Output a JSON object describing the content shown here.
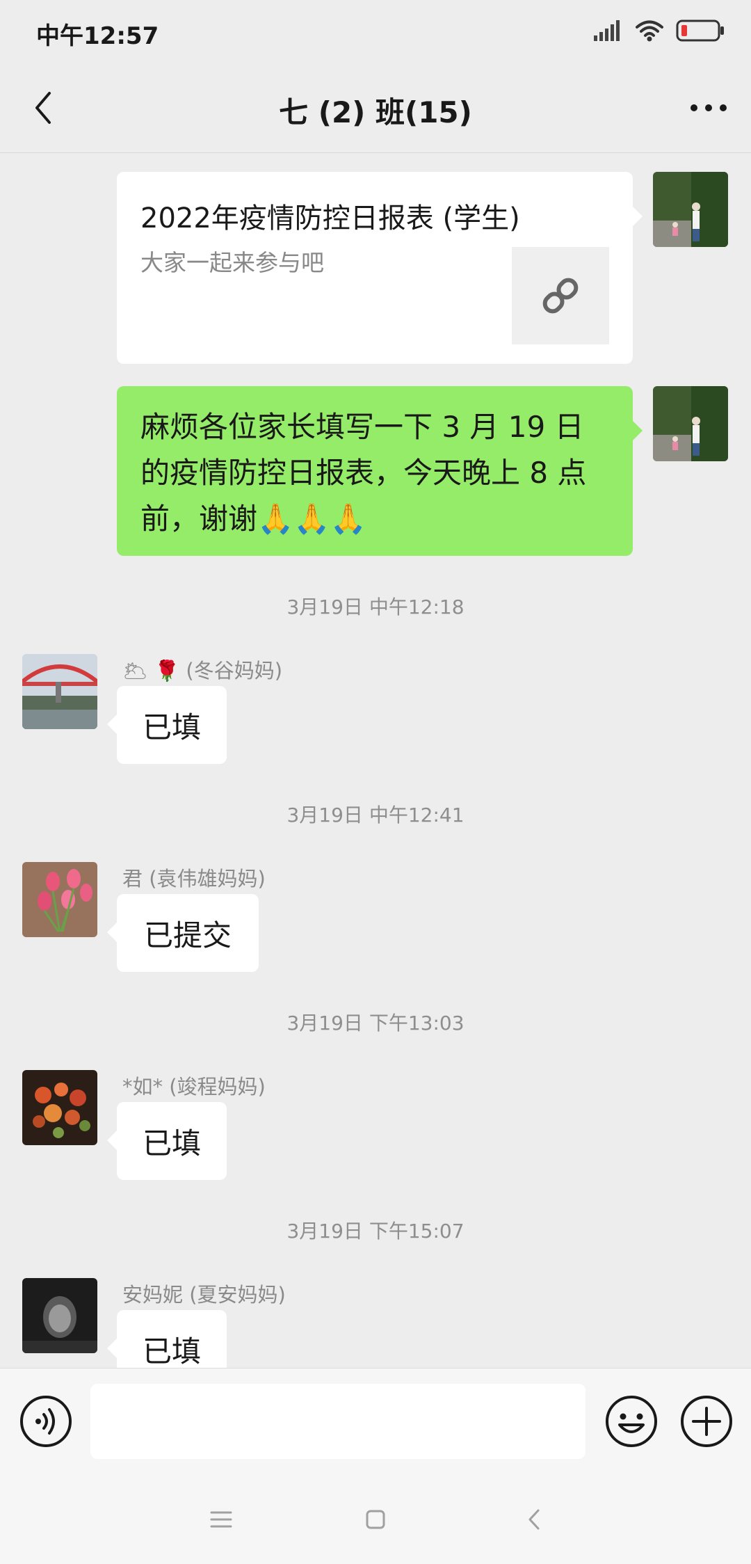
{
  "status_bar": {
    "time": "中午12:57"
  },
  "header": {
    "title": "七 (2) 班(15)"
  },
  "messages": {
    "link_card": {
      "title": "2022年疫情防控日报表 (学生)",
      "description": "大家一起来参与吧"
    },
    "own_text": {
      "lines": [
        "麻烦各位家长填写一下 3 月 19 日",
        "的疫情防控日报表，今天晚上 8 点",
        "前，谢谢"
      ],
      "emoji": "🙏🙏🙏"
    },
    "timestamps": [
      "3月19日 中午12:18",
      "3月19日 中午12:41",
      "3月19日 下午13:03",
      "3月19日 下午15:07"
    ],
    "replies": [
      {
        "sender_emoji": "🌥 🌹",
        "sender": "(冬谷妈妈)",
        "text": "已填"
      },
      {
        "sender": "君 (袁伟雄妈妈)",
        "text": "已提交"
      },
      {
        "sender": "*如* (竣程妈妈)",
        "text": "已填"
      },
      {
        "sender": "安妈妮 (夏安妈妈)",
        "text": "已填"
      }
    ]
  },
  "colors": {
    "background": "#ededed",
    "own_bubble": "#95ec69",
    "other_bubble": "#ffffff"
  }
}
